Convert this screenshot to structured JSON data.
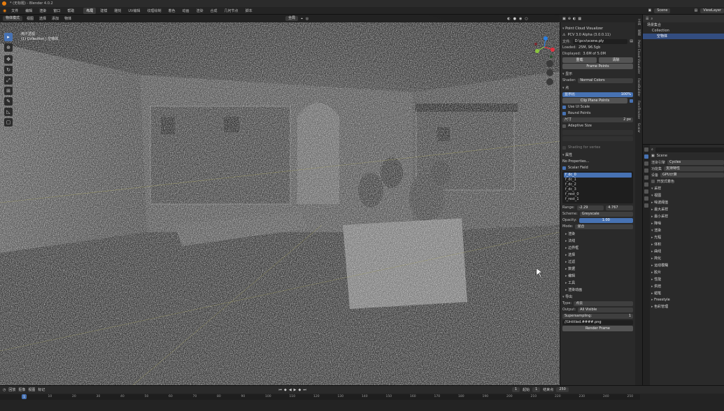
{
  "window": {
    "title": "* (无标题) - Blender 4.0.2"
  },
  "menu": [
    "文件",
    "编辑",
    "渲染",
    "窗口",
    "帮助"
  ],
  "workspaces": [
    {
      "label": "布局",
      "active": true
    },
    {
      "label": "建模",
      "active": false
    },
    {
      "label": "雕刻",
      "active": false
    },
    {
      "label": "UV编辑",
      "active": false
    },
    {
      "label": "纹理绘制",
      "active": false
    },
    {
      "label": "着色",
      "active": false
    },
    {
      "label": "动画",
      "active": false
    },
    {
      "label": "渲染",
      "active": false
    },
    {
      "label": "合成",
      "active": false
    },
    {
      "label": "几何节点",
      "active": false
    },
    {
      "label": "脚本",
      "active": false
    }
  ],
  "scene": {
    "name": "Scene",
    "layer": "ViewLayer"
  },
  "viewport": {
    "mode": "物体模式",
    "menus": [
      "视图",
      "选择",
      "添加",
      "物体"
    ],
    "transform_orient": "全局",
    "view_name": "用户透视",
    "collection_line": "(1) Collection | 空物体"
  },
  "npanel": {
    "addon_title": "Point Cloud Visualizer",
    "version": "PCV 3.0 Alpha (3.0.0.11)",
    "file_label": "文件:",
    "file_value": "D:\\pcv\\scene.ply",
    "loaded_label": "Loaded:",
    "loaded_value": "25M, 96.5gb",
    "displayed_label": "Displayed:",
    "displayed_value": "3.6M of 5.0M",
    "reload_label": "重载",
    "clear_label": "清除",
    "frame_label": "Frame Points",
    "display_section": "显示",
    "shader_label": "Shader:",
    "shader_value": "Normal Colors",
    "points_section": "点",
    "percent_label": "显示比",
    "percent_value": "100%",
    "clip_label": "Clip Plane Points",
    "use_ui_scale": "Use UI Scale",
    "round_points": "Round Points",
    "size_label": "尺寸",
    "size_value": "2 px",
    "adaptive_label": "Adaptive Size",
    "shading_label": "Shading for vertex",
    "props_section": "属性",
    "no_props": "No Properties...",
    "scalar_section": "Scalar Field",
    "scalar_fields": [
      "f_dc_0",
      "f_dc_1",
      "f_dc_2",
      "f_dc_3",
      "f_rest_0",
      "f_rest_1"
    ],
    "scalar_selected": 0,
    "range_label": "Range:",
    "range_min": "-2.29",
    "range_max": "4.767",
    "scheme_label": "Scheme:",
    "scheme_value": "Greyscale",
    "opacity_label": "Opacity:",
    "opacity_value": "1.00",
    "mode_label": "Mode:",
    "mode_value": "混合",
    "subsections": [
      "渲染",
      "法线",
      "边界框",
      "选择",
      "过滤",
      "数据",
      "编辑",
      "工具",
      "渲染动画"
    ],
    "export_section": "导出",
    "type_label": "Type:",
    "type_value": "点云",
    "output_label": "Output:",
    "output_value": "All Visible",
    "supersample_label": "Supersampling:",
    "supersample_value": "1",
    "path_value": "//Untitled.####.png",
    "render_label": "Render Frame"
  },
  "npanel_tabs": [
    "工具",
    "视图",
    "Point Cloud Visualizer",
    "FaceBuilder",
    "FaceTracker",
    "Scalar"
  ],
  "outliner": {
    "header": "场景集合",
    "items": [
      {
        "label": "场景集合",
        "selected": false,
        "indent": 0
      },
      {
        "label": "Collection",
        "selected": false,
        "indent": 1
      },
      {
        "label": "空物体",
        "selected": true,
        "indent": 2
      }
    ]
  },
  "properties": {
    "scene_name": "Scene",
    "render_engine_label": "渲染引擎",
    "render_engine_value": "Cycles",
    "feature_label": "功能集",
    "feature_value": "支持特性",
    "device_label": "设备",
    "device_value": "GPU计算",
    "denoise_check": "开放式着色",
    "sections": [
      {
        "label": "采样",
        "open": true
      },
      {
        "label": "视图",
        "open": true
      },
      {
        "label": "噪波阈值",
        "open": false
      },
      {
        "label": "最大采样",
        "open": false
      },
      {
        "label": "最小采样",
        "open": false
      },
      {
        "label": "降噪",
        "open": false
      },
      {
        "label": "渲染",
        "open": true
      },
      {
        "label": "光程",
        "open": false
      },
      {
        "label": "体积",
        "open": false
      },
      {
        "label": "曲线",
        "open": false
      },
      {
        "label": "简化",
        "open": false
      },
      {
        "label": "运动模糊",
        "open": false
      },
      {
        "label": "胶片",
        "open": false
      },
      {
        "label": "性能",
        "open": false
      },
      {
        "label": "烘焙",
        "open": false
      },
      {
        "label": "蜡笔",
        "open": false
      },
      {
        "label": "Freestyle",
        "open": false
      },
      {
        "label": "色彩管理",
        "open": false
      }
    ]
  },
  "timeline": {
    "menus": [
      "回放",
      "抠像",
      "视图",
      "标记"
    ],
    "current_frame": "1",
    "start_label": "起始",
    "start_value": "1",
    "end_label": "结束点",
    "end_value": "250",
    "ticks": [
      "0",
      "10",
      "20",
      "30",
      "40",
      "50",
      "60",
      "70",
      "80",
      "90",
      "100",
      "110",
      "120",
      "130",
      "140",
      "150",
      "160",
      "170",
      "180",
      "190",
      "200",
      "210",
      "220",
      "230",
      "240",
      "250"
    ]
  },
  "colors": {
    "accent": "#4772b3",
    "panel": "#2a2a2a",
    "header": "#242424",
    "x_axis": "#e3303e",
    "y_axis": "#8bc53e",
    "z_axis": "#2b7fe0"
  }
}
